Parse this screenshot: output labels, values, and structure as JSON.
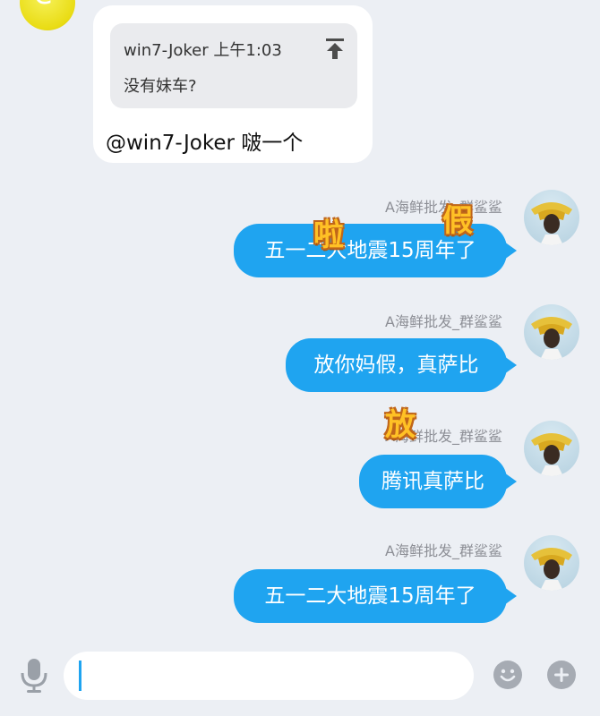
{
  "incoming": {
    "quote": {
      "author": "win7-Joker",
      "time": "上午1:03",
      "text": "没有妹车?"
    },
    "reply": "@win7-Joker 啵一个"
  },
  "outgoing": [
    {
      "nickname": "A海鲜批发_群鲨鲨",
      "text": "五一二大地震15周年了",
      "stickers": [
        "啦",
        "假"
      ]
    },
    {
      "nickname": "A海鲜批发_群鲨鲨",
      "text": "放你妈假，真萨比",
      "stickers": []
    },
    {
      "nickname": "A海鲜批发_群鲨鲨",
      "text": "腾讯真萨比",
      "stickers": [
        "放"
      ]
    },
    {
      "nickname": "A海鲜批发_群鲨鲨",
      "text": "五一二大地震15周年了",
      "stickers": []
    }
  ],
  "input": {
    "value": "",
    "placeholder": ""
  },
  "icons": {
    "voice": "microphone-icon",
    "emoji": "smiley-icon",
    "more": "plus-icon",
    "quote_jump": "jump-to-top-icon"
  },
  "colors": {
    "background": "#eceff4",
    "bubble_out": "#1fa4f0",
    "sticker_fill": "#ffc125"
  }
}
